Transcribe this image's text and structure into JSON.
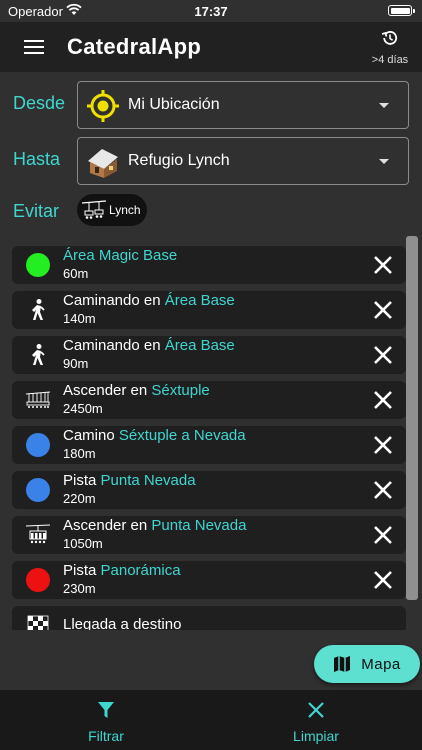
{
  "status_bar": {
    "carrier": "Operador",
    "time": "17:37"
  },
  "app_bar": {
    "title": "CatedralApp",
    "history_label": ">4 días"
  },
  "from": {
    "label": "Desde",
    "value": "Mi Ubicación",
    "icon": "location-target-icon"
  },
  "to": {
    "label": "Hasta",
    "value": "Refugio Lynch",
    "icon": "mountain-hut-icon"
  },
  "avoid": {
    "label": "Evitar",
    "chip_label": "Lynch",
    "chip_icon": "chairlift-icon"
  },
  "route": {
    "items": [
      {
        "icon": "dot",
        "color": "#22ee22",
        "prefix": "",
        "highlight": "Área Magic Base",
        "distance": "60m"
      },
      {
        "icon": "walk",
        "prefix": "Caminando en ",
        "highlight": "Área Base",
        "distance": "140m"
      },
      {
        "icon": "walk",
        "prefix": "Caminando en ",
        "highlight": "Área Base",
        "distance": "90m"
      },
      {
        "icon": "lift6",
        "prefix": "Ascender en ",
        "highlight": "Séxtuple",
        "distance": "2450m"
      },
      {
        "icon": "dot",
        "color": "#3b82e8",
        "prefix": "Camino ",
        "highlight": "Séxtuple a Nevada",
        "distance": "180m"
      },
      {
        "icon": "dot",
        "color": "#3b82e8",
        "prefix": "Pista ",
        "highlight": "Punta Nevada",
        "distance": "220m"
      },
      {
        "icon": "lift4",
        "prefix": "Ascender en ",
        "highlight": "Punta Nevada",
        "distance": "1050m"
      },
      {
        "icon": "dot",
        "color": "#ee1111",
        "prefix": "Pista ",
        "highlight": "Panorámica",
        "distance": "230m"
      }
    ],
    "destination_label": "Llegada a destino"
  },
  "map_button": {
    "label": "Mapa"
  },
  "bottom_bar": {
    "filter_label": "Filtrar",
    "clear_label": "Limpiar"
  },
  "colors": {
    "accent": "#3fd6d0",
    "fab": "#5de0d0",
    "background": "#303030",
    "item_bg": "#1f1f1f"
  }
}
